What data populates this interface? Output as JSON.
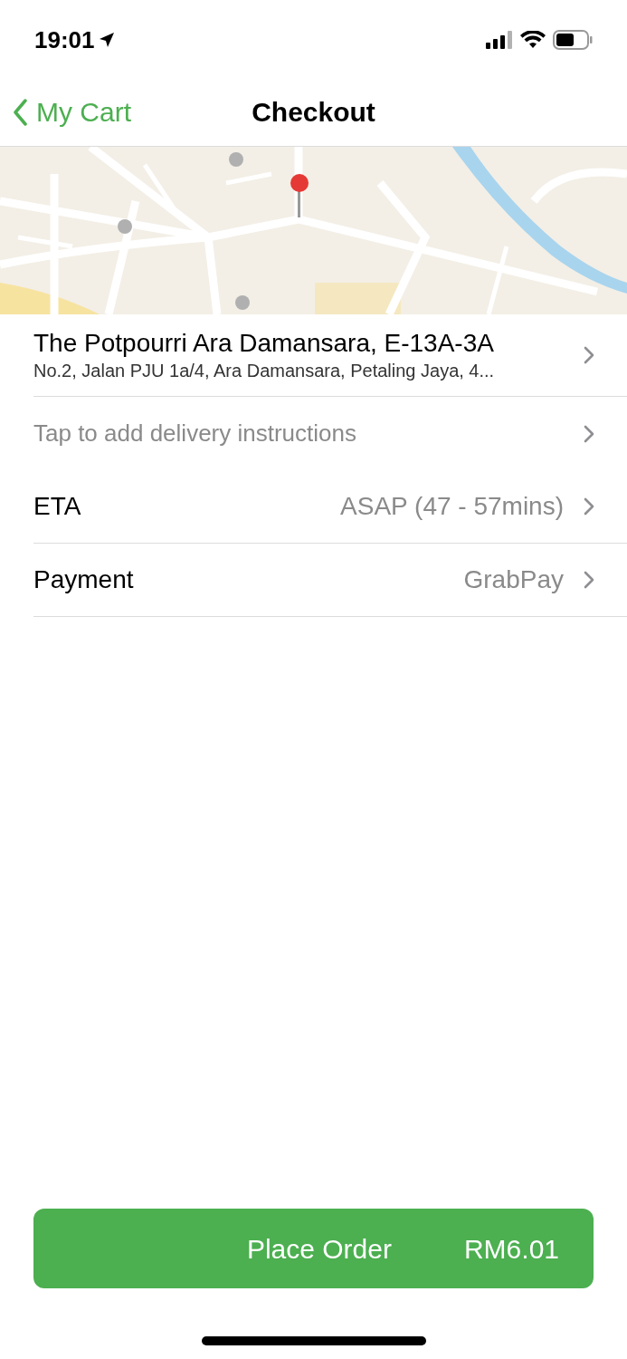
{
  "status_bar": {
    "time": "19:01"
  },
  "nav": {
    "back_label": "My Cart",
    "title": "Checkout"
  },
  "address": {
    "title": "The Potpourri Ara Damansara, E-13A-3A",
    "subtitle": "No.2, Jalan PJU 1a/4, Ara Damansara, Petaling Jaya, 4..."
  },
  "rows": [
    {
      "kind": "hint",
      "label": "Tap to add delivery instructions"
    },
    {
      "kind": "setting",
      "label": "ETA",
      "value": "ASAP (47 - 57mins)"
    },
    {
      "kind": "setting",
      "label": "Payment",
      "value": "GrabPay"
    }
  ],
  "button": {
    "label": "Place Order",
    "price": "RM6.01"
  }
}
